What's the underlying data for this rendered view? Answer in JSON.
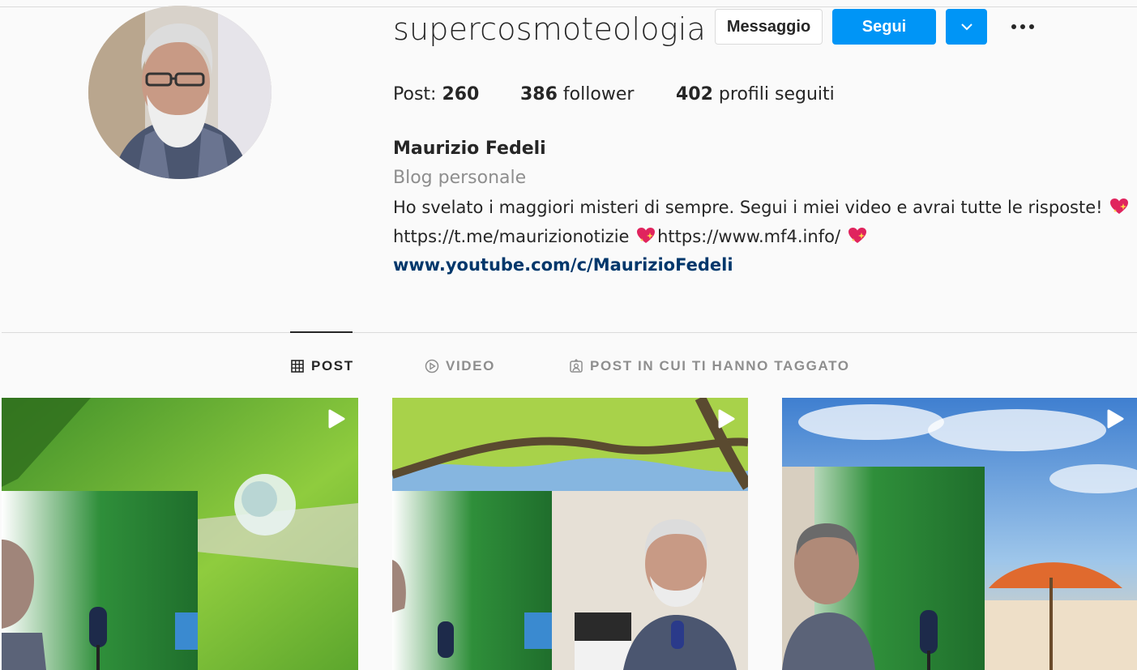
{
  "profile": {
    "username": "supercosmoteologia",
    "avatar": "profile-photo",
    "full_name": "Maurizio Fedeli",
    "category": "Blog personale",
    "bio_line1": "Ho svelato i maggiori misteri di sempre. Segui i miei video e avrai tutte le risposte! ",
    "bio_link1": "https://t.me/maurizionotizie ",
    "bio_link2": "https://www.mf4.info/ ",
    "website": "www.youtube.com/c/MaurizioFedeli",
    "emoji": "sparkling-heart"
  },
  "actions": {
    "message_label": "Messaggio",
    "follow_label": "Segui",
    "dropdown_icon": "chevron-down-icon",
    "more_icon": "more-options-icon"
  },
  "stats": {
    "posts_label": "Post: ",
    "posts_value": "260",
    "followers_value": "386",
    "followers_label": " follower",
    "following_value": "402",
    "following_label": " profili seguiti"
  },
  "tabs": [
    {
      "label": "POST",
      "icon": "grid-icon",
      "active": true
    },
    {
      "label": "VIDEO",
      "icon": "play-circle-icon",
      "active": false
    },
    {
      "label": "POST IN CUI TI HANNO TAGGATO",
      "icon": "tagged-icon",
      "active": false
    }
  ],
  "posts": [
    {
      "type": "video",
      "scene": "water-drop-on-leaf-with-presenter"
    },
    {
      "type": "video",
      "scene": "tree-canopy-with-presenter"
    },
    {
      "type": "video",
      "scene": "beach-umbrella-with-presenter"
    }
  ],
  "colors": {
    "primary_blue": "#0095f6",
    "link_navy": "#00376b",
    "text": "#262626",
    "muted": "#8e8e8e",
    "border": "#dbdbdb",
    "background": "#fafafa"
  }
}
